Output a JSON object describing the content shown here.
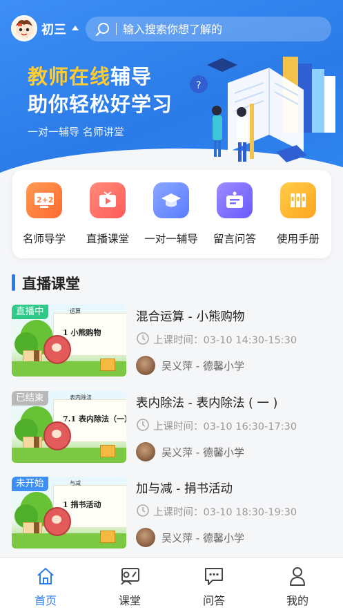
{
  "header": {
    "grade": "初三",
    "search_placeholder": "输入搜索你想了解的"
  },
  "banner": {
    "title_highlight": "教师在线",
    "title_rest": "辅导",
    "title_line2": "助你轻松好学习",
    "subtitle": "一对一辅导  名师讲堂"
  },
  "nav": {
    "items": [
      {
        "label": "名师导学",
        "icon": "math-board-icon",
        "color": "#ff7a3d"
      },
      {
        "label": "直播课堂",
        "icon": "live-video-icon",
        "color": "#ff6a6a"
      },
      {
        "label": "一对一辅导",
        "icon": "graduation-cap-icon",
        "color": "#6a8bff"
      },
      {
        "label": "留言问答",
        "icon": "message-board-icon",
        "color": "#7a6bff"
      },
      {
        "label": "使用手册",
        "icon": "books-icon",
        "color": "#ffb52e"
      }
    ]
  },
  "section": {
    "title": "直播课堂"
  },
  "courses": [
    {
      "status": "直播中",
      "status_color": "#2fc98a",
      "thumb_small": "运算",
      "thumb_title": "1   小熊购物",
      "title": "混合运算 - 小熊购物",
      "time": "上课时间：03-10 14:30-15:30",
      "teacher": "吴义萍 - 德馨小学"
    },
    {
      "status": "已结束",
      "status_color": "#b8b8b8",
      "thumb_small": "表内除法",
      "thumb_title": "7.1  表内除法（一）",
      "title": "表内除法 - 表内除法 ( 一 )",
      "time": "上课时间：03-10 16:30-17:30",
      "teacher": "吴义萍 - 德馨小学"
    },
    {
      "status": "未开始",
      "status_color": "#3d8ef5",
      "thumb_small": "与减",
      "thumb_title": "1   捐书活动",
      "title": "加与减 - 捐书活动",
      "time": "上课时间：03-10 18:30-19:30",
      "teacher": "吴义萍 - 德馨小学"
    }
  ],
  "tabbar": {
    "active_color": "#2b7be8",
    "items": [
      {
        "label": "首页",
        "icon": "home-icon",
        "active": true
      },
      {
        "label": "课堂",
        "icon": "classroom-icon",
        "active": false
      },
      {
        "label": "问答",
        "icon": "chat-icon",
        "active": false
      },
      {
        "label": "我的",
        "icon": "profile-icon",
        "active": false
      }
    ]
  }
}
